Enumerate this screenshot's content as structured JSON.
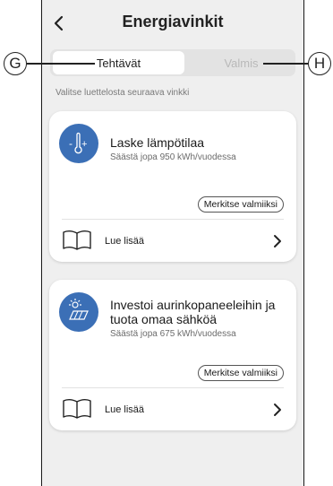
{
  "header": {
    "title": "Energiavinkit"
  },
  "tabs": [
    {
      "label": "Tehtävät",
      "active": true
    },
    {
      "label": "Valmis",
      "active": false
    }
  ],
  "callouts": {
    "left": "G",
    "right": "H"
  },
  "hint": "Valitse luettelosta seuraava vinkki",
  "cards": [
    {
      "icon": "thermometer-icon",
      "title": "Laske lämpötilaa",
      "subtitle": "Säästä jopa 950 kWh/vuodessa",
      "mark_label": "Merkitse valmiiksi",
      "read_more": "Lue lisää"
    },
    {
      "icon": "solar-panel-icon",
      "title": "Investoi aurinkopaneeleihin ja tuota omaa sähköä",
      "subtitle": "Säästä jopa 675 kWh/vuodessa",
      "mark_label": "Merkitse valmiiksi",
      "read_more": "Lue lisää"
    }
  ],
  "colors": {
    "accent": "#3b6fb6",
    "background": "#efefef"
  }
}
